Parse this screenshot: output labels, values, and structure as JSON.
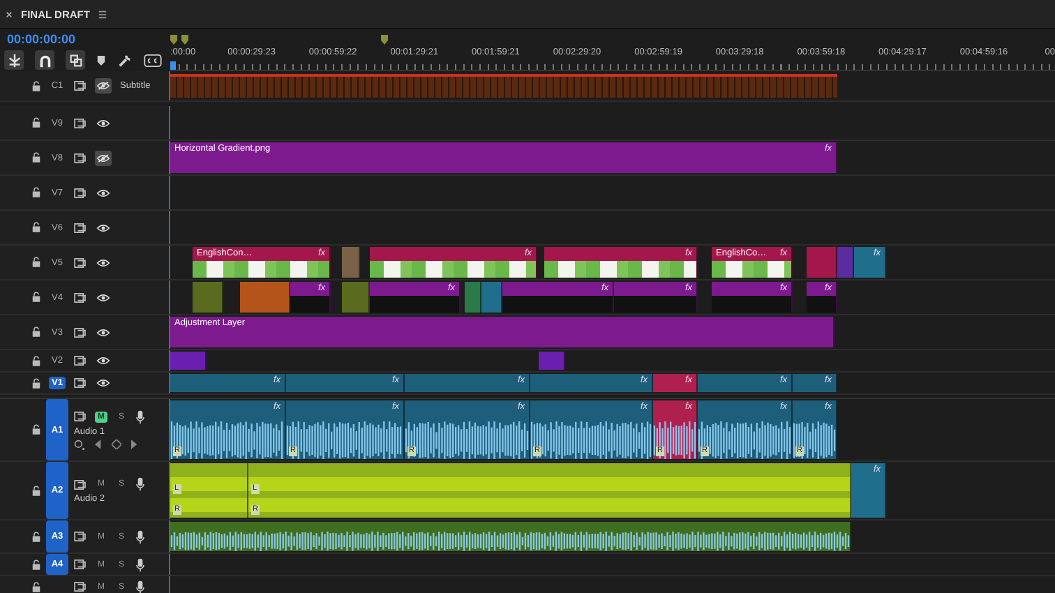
{
  "panel": {
    "title": "FINAL DRAFT",
    "timecode": "00:00:00:00"
  },
  "ruler": {
    "labels": [
      ":00:00",
      "00:00:29:23",
      "00:00:59:22",
      "00:01:29:21",
      "00:01:59:21",
      "00:02:29:20",
      "00:02:59:19",
      "00:03:29:18",
      "00:03:59:18",
      "00:04:29:17",
      "00:04:59:16",
      "00"
    ]
  },
  "tracks": [
    {
      "kind": "subtitle",
      "id": "C1",
      "name": "Subtitle",
      "visible": false,
      "targeted": false
    },
    {
      "kind": "video",
      "id": "V9",
      "visible": true,
      "targeted": false
    },
    {
      "kind": "video",
      "id": "V8",
      "visible": false,
      "targeted": false,
      "clips": [
        {
          "kind": "solid",
          "label": "Horizontal Gradient.png",
          "badge": "fx",
          "color": "#7d1b8e"
        }
      ]
    },
    {
      "kind": "video",
      "id": "V7",
      "visible": true,
      "targeted": false
    },
    {
      "kind": "video",
      "id": "V6",
      "visible": true,
      "targeted": false
    },
    {
      "kind": "video",
      "id": "V5",
      "visible": true,
      "targeted": false,
      "clips": [
        {
          "kind": "thumbs",
          "label": "EnglishCon…",
          "badge": "fx",
          "color": "#a3174a"
        },
        {
          "kind": "solid",
          "color": "#7a6248"
        },
        {
          "kind": "thumbs",
          "badge": "fx",
          "color": "#a3174a"
        },
        {
          "kind": "thumbs",
          "badge": "fx",
          "color": "#a3174a"
        },
        {
          "kind": "thumbs",
          "label": "EnglishCo…",
          "badge": "fx",
          "color": "#a3174a"
        },
        {
          "kind": "solid",
          "color": "#a3174a"
        },
        {
          "kind": "solid",
          "color": "#5b2ca0"
        },
        {
          "kind": "solid",
          "badge": "fx",
          "color": "#1f6e8c"
        }
      ]
    },
    {
      "kind": "video",
      "id": "V4",
      "visible": true,
      "targeted": false,
      "clips": [
        {
          "kind": "solid",
          "color": "#5a6a1e"
        },
        {
          "kind": "solid",
          "color": "#b5541a"
        },
        {
          "kind": "split",
          "badge": "fx",
          "color": "#7d1b8e"
        },
        {
          "kind": "solid",
          "color": "#5a6a1e"
        },
        {
          "kind": "split",
          "badge": "fx",
          "color": "#7d1b8e"
        },
        {
          "kind": "solid",
          "color": "#2a7a4a"
        },
        {
          "kind": "solid",
          "color": "#1f6e8c"
        },
        {
          "kind": "split",
          "badge": "fx",
          "color": "#7d1b8e"
        },
        {
          "kind": "split",
          "badge": "fx",
          "color": "#7d1b8e"
        },
        {
          "kind": "split",
          "badge": "fx",
          "color": "#7d1b8e"
        },
        {
          "kind": "split",
          "badge": "fx",
          "color": "#7d1b8e"
        }
      ]
    },
    {
      "kind": "video",
      "id": "V3",
      "visible": true,
      "targeted": false,
      "clips": [
        {
          "kind": "solid",
          "label": "Adjustment Layer",
          "color": "#7d1b8e"
        }
      ]
    },
    {
      "kind": "video",
      "id": "V2",
      "visible": true,
      "targeted": false,
      "clips": [
        {
          "kind": "solid",
          "color": "#6a1fb0"
        },
        {
          "kind": "solid",
          "color": "#6a1fb0"
        }
      ]
    },
    {
      "kind": "video",
      "id": "V1",
      "visible": true,
      "targeted": true,
      "clips": [
        {
          "kind": "solid",
          "badge": "fx",
          "color": "#1d5f7a"
        },
        {
          "kind": "solid",
          "badge": "fx",
          "color": "#1d5f7a"
        },
        {
          "kind": "solid",
          "badge": "fx",
          "color": "#1d5f7a"
        },
        {
          "kind": "solid",
          "badge": "fx",
          "color": "#1d5f7a"
        },
        {
          "kind": "solid",
          "badge": "fx",
          "color": "#b0204e"
        },
        {
          "kind": "solid",
          "badge": "fx",
          "color": "#1d5f7a"
        },
        {
          "kind": "solid",
          "badge": "fx",
          "color": "#1d5f7a"
        }
      ]
    },
    {
      "kind": "audio",
      "id": "A1",
      "name": "Audio 1",
      "mute_label": "M",
      "solo_label": "S",
      "muted": true,
      "solo": false,
      "expanded": true,
      "targeted": true,
      "clips": [
        {
          "kind": "wave",
          "badge": "fx",
          "marks": [
            "R"
          ],
          "color": "#1d5f7a"
        },
        {
          "kind": "wave",
          "badge": "fx",
          "marks": [
            "R"
          ],
          "color": "#1d5f7a"
        },
        {
          "kind": "wave",
          "badge": "fx",
          "marks": [
            "R"
          ],
          "color": "#1d5f7a"
        },
        {
          "kind": "wave",
          "badge": "fx",
          "marks": [
            "R"
          ],
          "color": "#1d5f7a"
        },
        {
          "kind": "wave",
          "badge": "fx",
          "marks": [
            "R"
          ],
          "color": "#b0204e"
        },
        {
          "kind": "wave",
          "badge": "fx",
          "marks": [
            "R"
          ],
          "color": "#1d5f7a"
        },
        {
          "kind": "wave",
          "badge": "fx",
          "marks": [
            "R"
          ],
          "color": "#1d5f7a"
        }
      ]
    },
    {
      "kind": "audio",
      "id": "A2",
      "name": "Audio 2",
      "mute_label": "M",
      "solo_label": "S",
      "muted": false,
      "solo": false,
      "expanded": false,
      "targeted": true,
      "clips": [
        {
          "kind": "stereo",
          "marks": [
            "L",
            "R"
          ],
          "color": "#8fb21c"
        },
        {
          "kind": "stereo",
          "marks": [
            "L",
            "R"
          ],
          "color": "#8fb21c"
        },
        {
          "kind": "solid",
          "badge": "fx",
          "color": "#1f6e8c"
        }
      ]
    },
    {
      "kind": "audio",
      "id": "A3",
      "mute_label": "M",
      "solo_label": "S",
      "muted": false,
      "solo": false,
      "expanded": false,
      "targeted": true,
      "clips": [
        {
          "kind": "wave",
          "color": "#3f6e1f"
        }
      ]
    },
    {
      "kind": "audio",
      "id": "A4",
      "mute_label": "M",
      "solo_label": "S",
      "muted": false,
      "solo": false,
      "expanded": false,
      "targeted": true
    },
    {
      "kind": "audio",
      "mute_label": "M",
      "solo_label": "S",
      "muted": false,
      "solo": false,
      "expanded": false
    }
  ]
}
